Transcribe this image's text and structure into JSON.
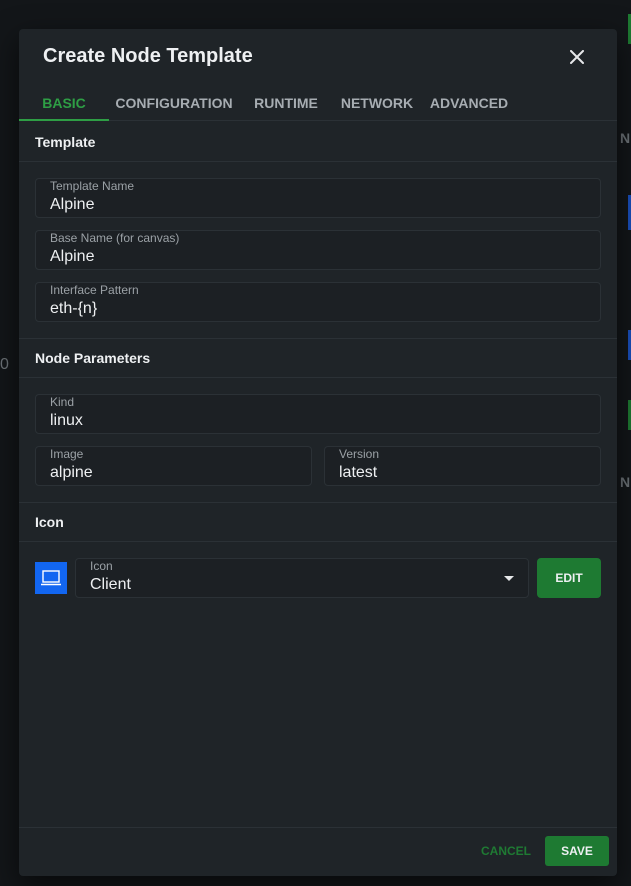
{
  "dialog": {
    "title": "Create Node Template",
    "tabs": [
      {
        "label": "BASIC"
      },
      {
        "label": "CONFIGURATION"
      },
      {
        "label": "RUNTIME"
      },
      {
        "label": "NETWORK"
      },
      {
        "label": "ADVANCED"
      }
    ]
  },
  "template": {
    "heading": "Template",
    "template_name": {
      "label": "Template Name",
      "value": "Alpine"
    },
    "base_name": {
      "label": "Base Name (for canvas)",
      "value": "Alpine"
    },
    "interface_pattern": {
      "label": "Interface Pattern",
      "value": "eth-{n}"
    }
  },
  "node_parameters": {
    "heading": "Node Parameters",
    "kind": {
      "label": "Kind",
      "value": "linux"
    },
    "image": {
      "label": "Image",
      "value": "alpine"
    },
    "version": {
      "label": "Version",
      "value": "latest"
    }
  },
  "icon_section": {
    "heading": "Icon",
    "preview_icon": "laptop-icon",
    "select": {
      "label": "Icon",
      "value": "Client"
    },
    "edit_label": "EDIT"
  },
  "footer": {
    "cancel_label": "CANCEL",
    "save_label": "SAVE"
  },
  "background": {
    "edge_letter_1": "N",
    "edge_letter_2": "N",
    "edge_digit": "0"
  },
  "colors": {
    "accent": "#2e9e45",
    "button_green": "#1e7a32",
    "icon_blue": "#1266f1",
    "dialog_bg": "#1f2428"
  }
}
